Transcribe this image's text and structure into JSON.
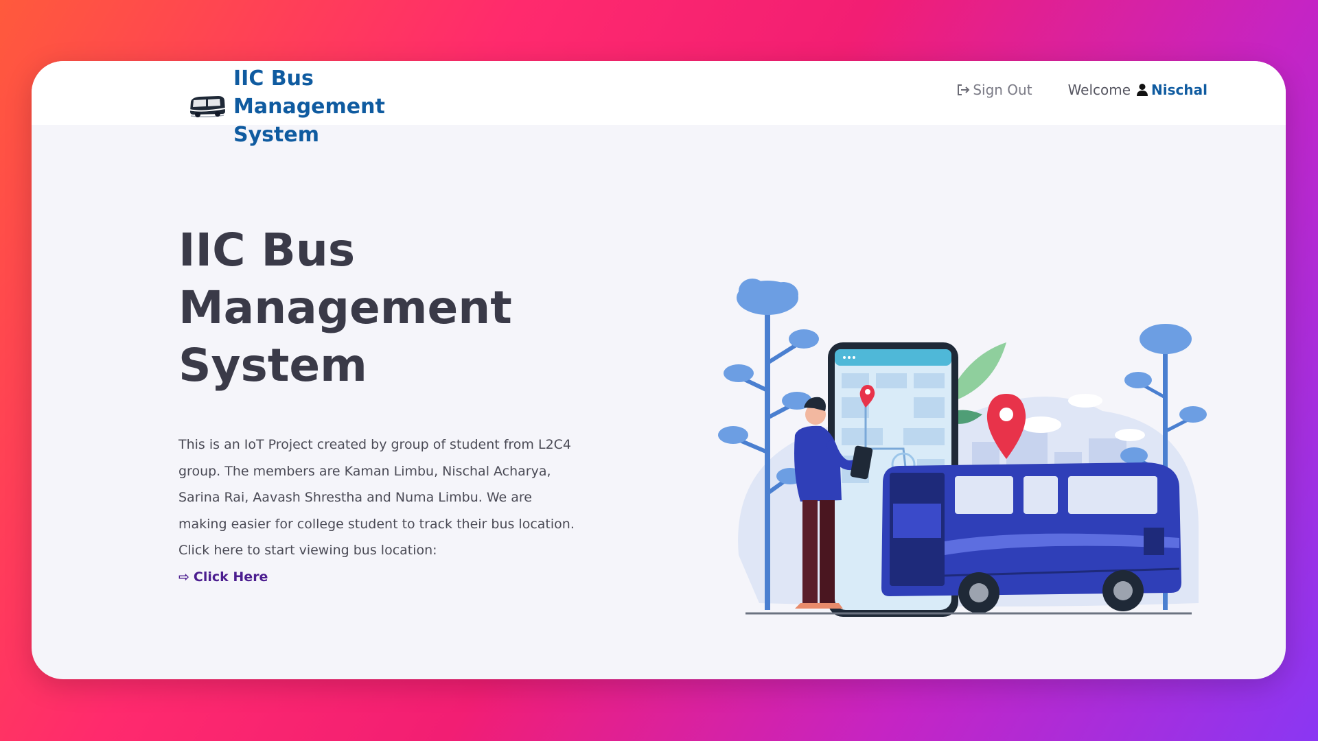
{
  "brand": {
    "title": "IIC Bus Management System",
    "logo_icon": "bus-icon"
  },
  "nav": {
    "sign_out_label": "Sign Out",
    "sign_out_icon": "sign-out-icon",
    "welcome_text": "Welcome",
    "user_icon": "user-icon",
    "username": "Nischal"
  },
  "hero": {
    "title_lines": [
      "IIC Bus",
      "Management",
      "System"
    ],
    "description": "This is an IoT Project created by group of student from L2C4 group. The members are Kaman Limbu, Nischal Acharya, Sarina Rai, Aavash Shrestha and Numa Limbu. We are making easier for college student to track their bus location.",
    "cta_text": "Click here to start viewing bus location:",
    "cta_arrow": "⇨",
    "cta_link": "Click Here"
  },
  "colors": {
    "brand_blue": "#0f5ba0",
    "heading": "#3a3a48",
    "link_purple": "#4b1d8f",
    "bus_blue": "#2f3fb8",
    "pin_red": "#e8334a"
  }
}
